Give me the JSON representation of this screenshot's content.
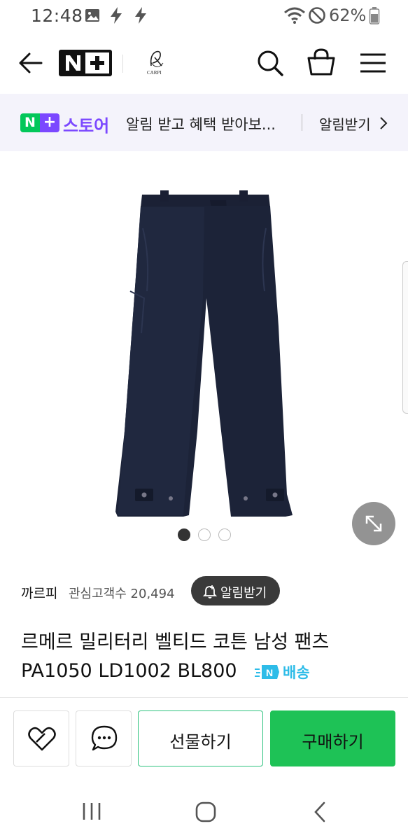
{
  "status_bar": {
    "time": "12:48",
    "battery": "62%",
    "icons": [
      "gallery-icon",
      "lightning-icon",
      "lightning-icon",
      "wifi-icon",
      "no-disturb-icon",
      "battery-icon"
    ]
  },
  "header": {
    "logo_text": "N+",
    "store_logo_text": "CARPI",
    "icons": [
      "back-arrow-icon",
      "search-icon",
      "cart-icon",
      "menu-icon"
    ]
  },
  "promo": {
    "badge_n": "N",
    "badge_plus": "+",
    "store_label": "스토어",
    "message": "알림 받고 혜택 받아보...",
    "action": "알림받기",
    "action_icon": "chevron-right-icon"
  },
  "gallery": {
    "image_subject": "navy belted military cotton pants",
    "current_index": 0,
    "count": 3
  },
  "product": {
    "seller": "까르피",
    "interest_label": "관심고객수",
    "interest_count": "20,494",
    "notify_label": "알림받기",
    "title_line1": "르메르 밀리터리 벨티드 코튼 남성 팬츠",
    "title_line2": "PA1050 LD1002 BL800",
    "shipping_badge_letter": "N",
    "shipping_label": "배송"
  },
  "actions": {
    "gift_label": "선물하기",
    "buy_label": "구매하기"
  },
  "colors": {
    "naver_green": "#03c75a",
    "plus_purple": "#7b48ff",
    "buy_green": "#1ec256",
    "ship_blue": "#2ebce8"
  }
}
